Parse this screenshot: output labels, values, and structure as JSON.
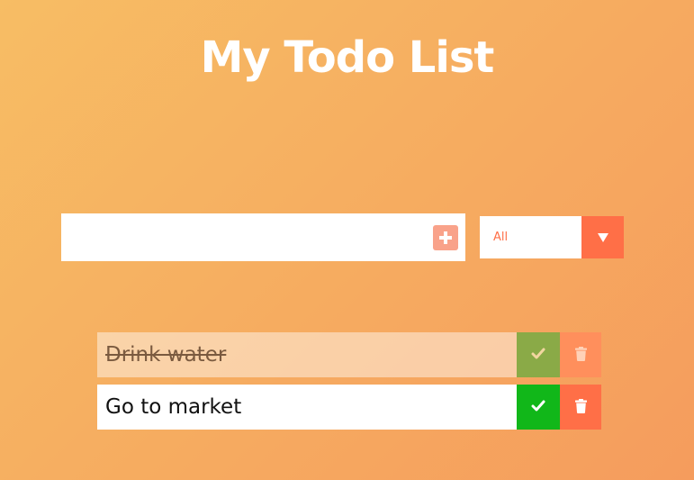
{
  "header": {
    "title": "My Todo List"
  },
  "form": {
    "input_value": "",
    "input_placeholder": "",
    "add_icon": "plus-icon",
    "filter": {
      "selected": "All",
      "options": [
        "All"
      ],
      "arrow_icon": "chevron-down-icon"
    }
  },
  "todos": [
    {
      "text": "Drink water",
      "completed": true
    },
    {
      "text": "Go to market",
      "completed": false
    }
  ],
  "colors": {
    "gradient_start": "#f7bd64",
    "gradient_end": "#f59c5d",
    "accent": "#ff6f47",
    "check_green": "#11b719",
    "check_muted": "#8aaa47"
  }
}
